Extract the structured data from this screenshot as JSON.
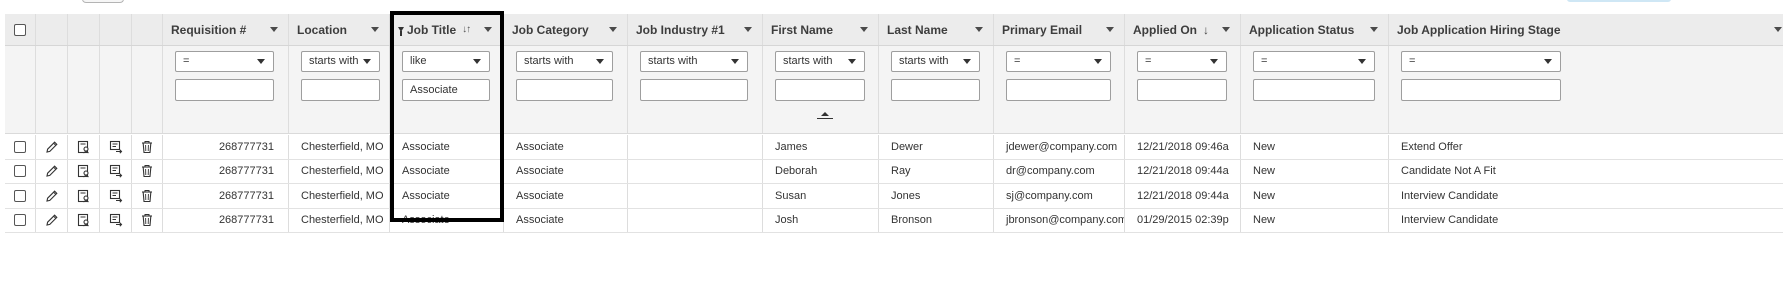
{
  "columns": [
    {
      "key": "chk",
      "label": "",
      "width": 31
    },
    {
      "key": "edit",
      "label": "",
      "width": 32
    },
    {
      "key": "view",
      "label": "",
      "width": 32
    },
    {
      "key": "move",
      "label": "",
      "width": 32
    },
    {
      "key": "del",
      "label": "",
      "width": 31
    },
    {
      "key": "req",
      "label": "Requisition #",
      "width": 126
    },
    {
      "key": "loc",
      "label": "Location",
      "width": 101
    },
    {
      "key": "title",
      "label": "Job Title",
      "width": 114
    },
    {
      "key": "cat",
      "label": "Job Category",
      "width": 124
    },
    {
      "key": "ind",
      "label": "Job Industry #1",
      "width": 135
    },
    {
      "key": "first",
      "label": "First Name",
      "width": 116
    },
    {
      "key": "last",
      "label": "Last Name",
      "width": 115
    },
    {
      "key": "email",
      "label": "Primary Email",
      "width": 131
    },
    {
      "key": "applied",
      "label": "Applied On",
      "width": 116
    },
    {
      "key": "status",
      "label": "Application Status",
      "width": 148
    },
    {
      "key": "stage",
      "label": "Job Application Hiring Stage",
      "width": 404
    }
  ],
  "filters": {
    "req": {
      "op": "=",
      "value": "",
      "select_width": 99,
      "input_width": 99
    },
    "loc": {
      "op": "starts with",
      "value": "",
      "select_width": 79,
      "input_width": 79
    },
    "title": {
      "op": "like",
      "value": "Associate",
      "select_width": 88,
      "input_width": 88
    },
    "cat": {
      "op": "starts with",
      "value": "",
      "select_width": 97,
      "input_width": 97
    },
    "ind": {
      "op": "starts with",
      "value": "",
      "select_width": 108,
      "input_width": 108
    },
    "first": {
      "op": "starts with",
      "value": "",
      "select_width": 90,
      "input_width": 90
    },
    "last": {
      "op": "starts with",
      "value": "",
      "select_width": 89,
      "input_width": 89
    },
    "email": {
      "op": "=",
      "value": "",
      "select_width": 105,
      "input_width": 105
    },
    "applied": {
      "op": "=",
      "value": "",
      "select_width": 90,
      "input_width": 90
    },
    "status": {
      "op": "=",
      "value": "",
      "select_width": 122,
      "input_width": 122
    },
    "stage": {
      "op": "=",
      "value": "",
      "select_width": 160,
      "input_width": 160
    }
  },
  "rows": [
    {
      "req": "268777731",
      "loc": "Chesterfield, MO",
      "title": "Associate",
      "cat": "Associate",
      "ind": "",
      "first": "James",
      "last": "Dewer",
      "email": "jdewer@company.com",
      "applied": "12/21/2018 09:46a",
      "status": "New",
      "stage": "Extend Offer"
    },
    {
      "req": "268777731",
      "loc": "Chesterfield, MO",
      "title": "Associate",
      "cat": "Associate",
      "ind": "",
      "first": "Deborah",
      "last": "Ray",
      "email": "dr@company.com",
      "applied": "12/21/2018 09:44a",
      "status": "New",
      "stage": "Candidate Not A Fit"
    },
    {
      "req": "268777731",
      "loc": "Chesterfield, MO",
      "title": "Associate",
      "cat": "Associate",
      "ind": "",
      "first": "Susan",
      "last": "Jones",
      "email": "sj@company.com",
      "applied": "12/21/2018 09:44a",
      "status": "New",
      "stage": "Interview Candidate"
    },
    {
      "req": "268777731",
      "loc": "Chesterfield, MO",
      "title": "Associate",
      "cat": "Associate",
      "ind": "",
      "first": "Josh",
      "last": "Bronson",
      "email": "jbronson@company.com",
      "applied": "01/29/2015 02:39p",
      "status": "New",
      "stage": "Interview Candidate"
    }
  ],
  "icons": {
    "edit": "pencil-icon",
    "view": "view-applicant-icon",
    "move": "move-applicant-icon",
    "del": "trash-icon"
  },
  "colors": {
    "header_bg": "#ececec",
    "filter_bg": "#f4f4f4",
    "highlight": "#000000"
  }
}
